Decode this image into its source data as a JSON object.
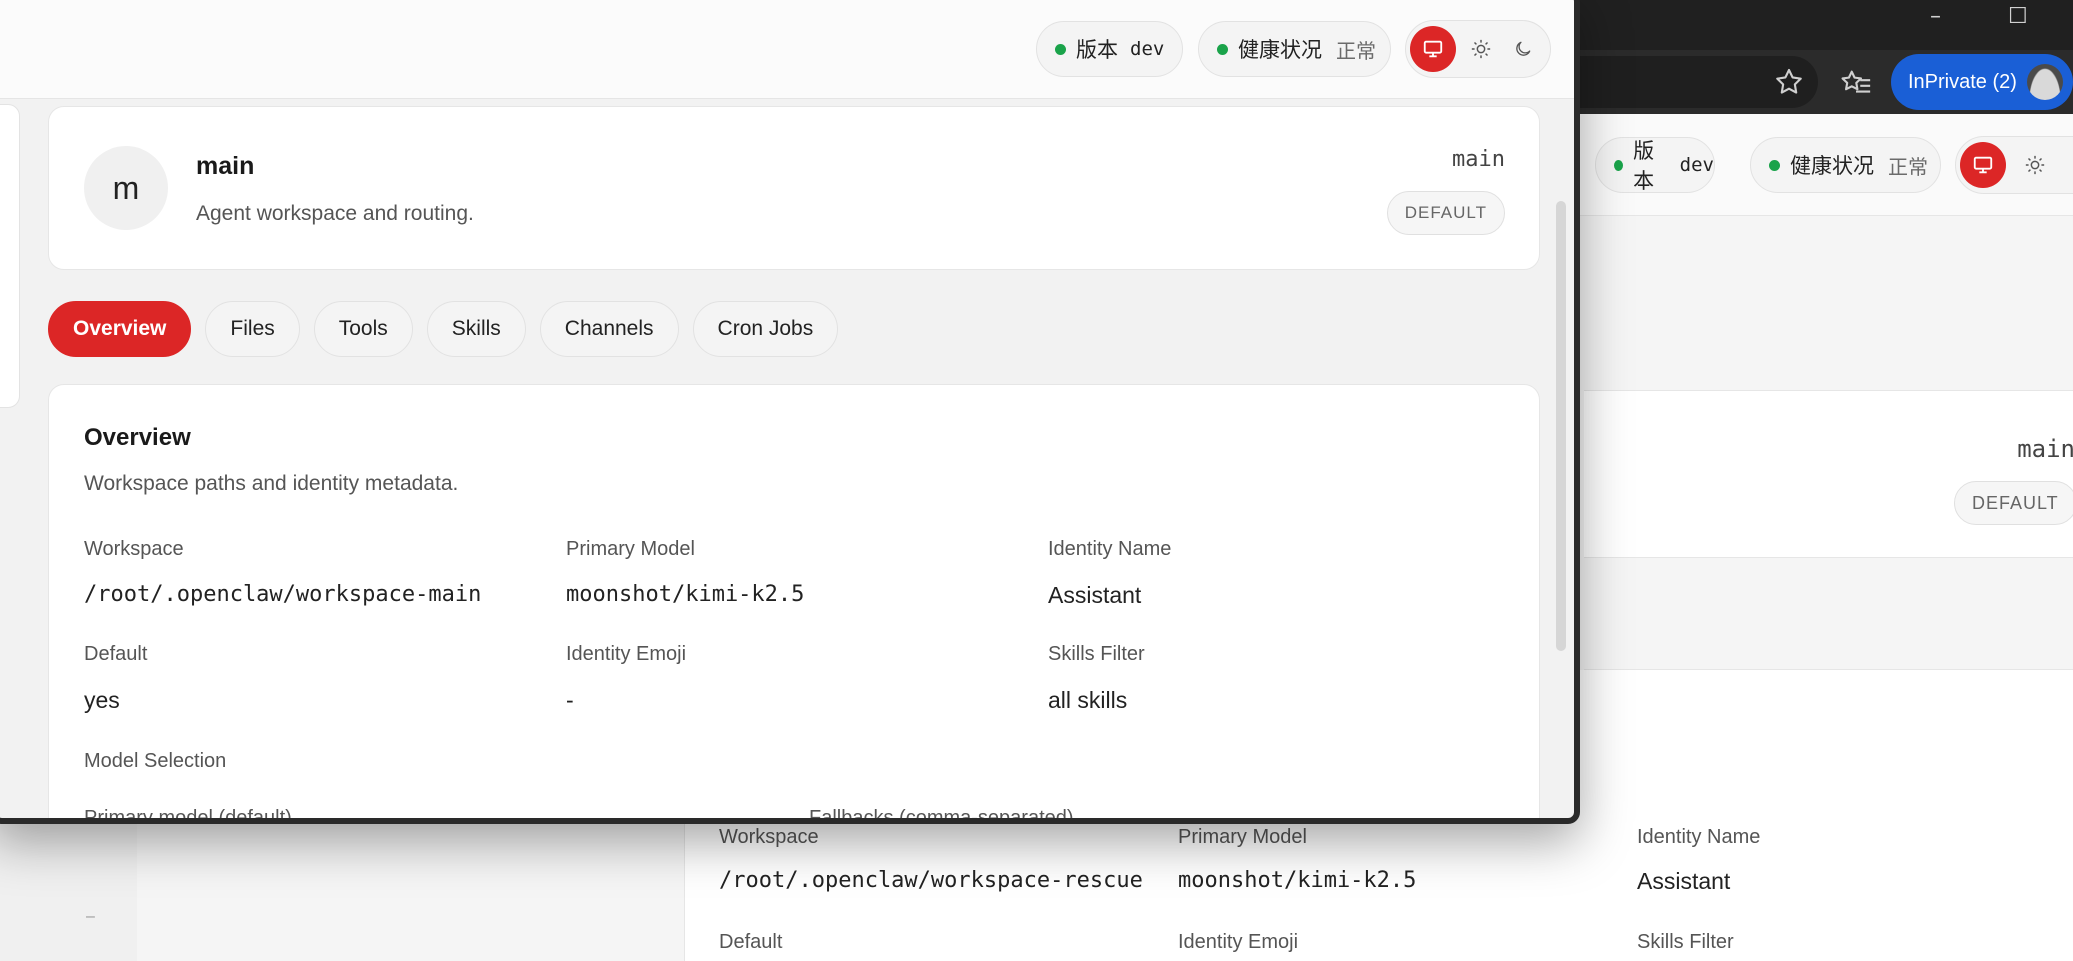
{
  "background": {
    "browser": {
      "inprivate_label": "InPrivate (2)",
      "window_controls": [
        "–",
        "☐"
      ]
    },
    "topbar": {
      "version_label": "版本",
      "version_value": "dev",
      "health_label": "健康状况",
      "health_value": "正常"
    },
    "agent_card": {
      "id": "main",
      "badge": "DEFAULT"
    },
    "fields": [
      {
        "label": "Workspace",
        "value": "/root/.openclaw/workspace-rescue"
      },
      {
        "label": "Primary Model",
        "value": "moonshot/kimi-k2.5"
      },
      {
        "label": "Identity Name",
        "value": "Assistant"
      },
      {
        "label": "Default",
        "value": ""
      },
      {
        "label": "Identity Emoji",
        "value": ""
      },
      {
        "label": "Skills Filter",
        "value": ""
      }
    ],
    "sidebar_mark": "–"
  },
  "front": {
    "topbar": {
      "version_label": "版本",
      "version_value": "dev",
      "health_label": "健康状况",
      "health_value": "正常"
    },
    "agent": {
      "avatar_letter": "m",
      "name": "main",
      "subtitle": "Agent workspace and routing.",
      "id": "main",
      "badge": "DEFAULT"
    },
    "tabs": [
      {
        "label": "Overview",
        "active": true
      },
      {
        "label": "Files",
        "active": false
      },
      {
        "label": "Tools",
        "active": false
      },
      {
        "label": "Skills",
        "active": false
      },
      {
        "label": "Channels",
        "active": false
      },
      {
        "label": "Cron Jobs",
        "active": false
      }
    ],
    "overview": {
      "title": "Overview",
      "subtitle": "Workspace paths and identity metadata.",
      "fields": [
        {
          "label": "Workspace",
          "value": "/root/.openclaw/workspace-main"
        },
        {
          "label": "Primary Model",
          "value": "moonshot/kimi-k2.5"
        },
        {
          "label": "Identity Name",
          "value": "Assistant"
        },
        {
          "label": "Default",
          "value": "yes"
        },
        {
          "label": "Identity Emoji",
          "value": "-"
        },
        {
          "label": "Skills Filter",
          "value": "all skills"
        }
      ],
      "model_selection_label": "Model Selection",
      "primary_model_label": "Primary model (default)",
      "fallbacks_label": "Fallbacks (comma-separated)"
    }
  },
  "colors": {
    "accent": "#dc2626",
    "status_ok": "#1aa34a",
    "inprivate": "#1a5fd6"
  },
  "icons": [
    "monitor-icon",
    "sun-icon",
    "moon-icon",
    "star-icon",
    "favorites-icon",
    "profile-icon"
  ]
}
